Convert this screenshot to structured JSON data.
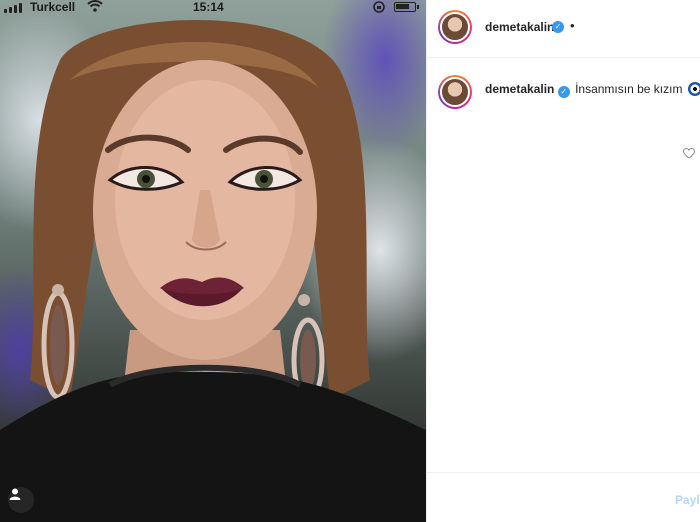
{
  "status_bar": {
    "carrier": "Turkcell",
    "time": "15:14",
    "battery_level": 0.75
  },
  "post": {
    "username": "demetakalin",
    "header_separator": "•",
    "caption_username": "demetakalin",
    "caption_text": "İnsanmısın be kızım",
    "caption_emoji": "nazar-amulet-icon",
    "share_label": "Payla"
  },
  "colors": {
    "verified": "#3897f0",
    "share_disabled": "#b3d7fb",
    "story_ring": [
      "#f58529",
      "#dd2a7b",
      "#8134af"
    ]
  }
}
